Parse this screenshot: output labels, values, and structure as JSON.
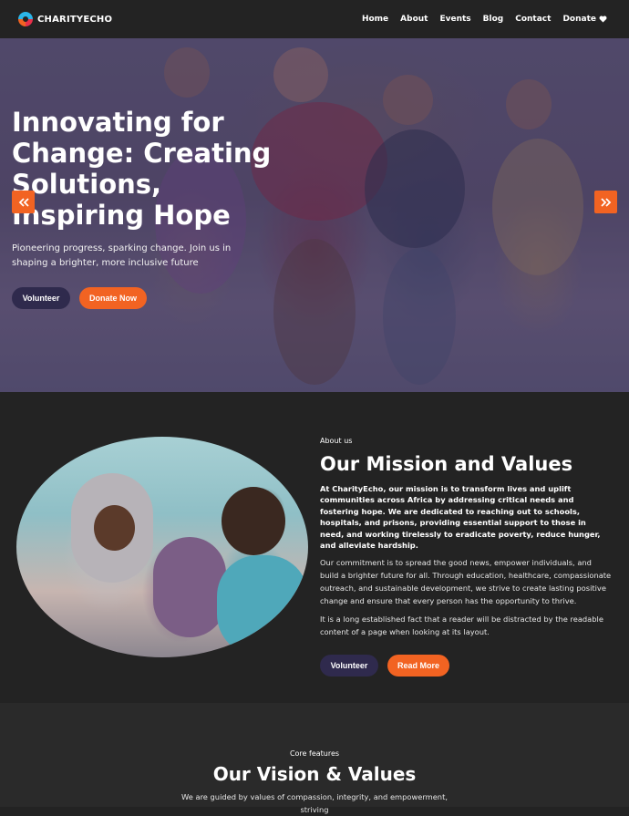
{
  "nav": {
    "brand": "CHARITYECHO",
    "links": [
      "Home",
      "About",
      "Events",
      "Blog",
      "Contact"
    ],
    "donate": "Donate"
  },
  "hero": {
    "title": "Innovating for Change: Creating Solutions, Inspiring Hope",
    "subtitle": "Pioneering progress, sparking change. Join us in shaping a brighter, more inclusive future",
    "btn_volunteer": "Volunteer",
    "btn_donate": "Donate Now"
  },
  "about": {
    "eyebrow": "About us",
    "title": "Our Mission and Values",
    "lead": "At CharityEcho, our mission is to transform lives and uplift communities across Africa by addressing critical needs and fostering hope. We are dedicated to reaching out to schools, hospitals, and prisons, providing essential support to those in need, and working tirelessly to eradicate poverty, reduce hunger, and alleviate hardship.",
    "body": "Our commitment is to spread the good news, empower individuals, and build a brighter future for all. Through education, healthcare, compassionate outreach, and sustainable development, we strive to create lasting positive change and ensure that every person has the opportunity to thrive.",
    "extra": "It is a long established fact that a reader will be distracted by the readable content of a page when looking at its layout.",
    "btn_volunteer": "Volunteer",
    "btn_read": "Read More"
  },
  "core": {
    "eyebrow": "Core features",
    "title": "Our Vision & Values",
    "subtitle": "We are guided by values of compassion, integrity, and empowerment, striving"
  },
  "colors": {
    "accent": "#f26322",
    "dark_button": "#2f2a4d",
    "background": "#232323"
  }
}
